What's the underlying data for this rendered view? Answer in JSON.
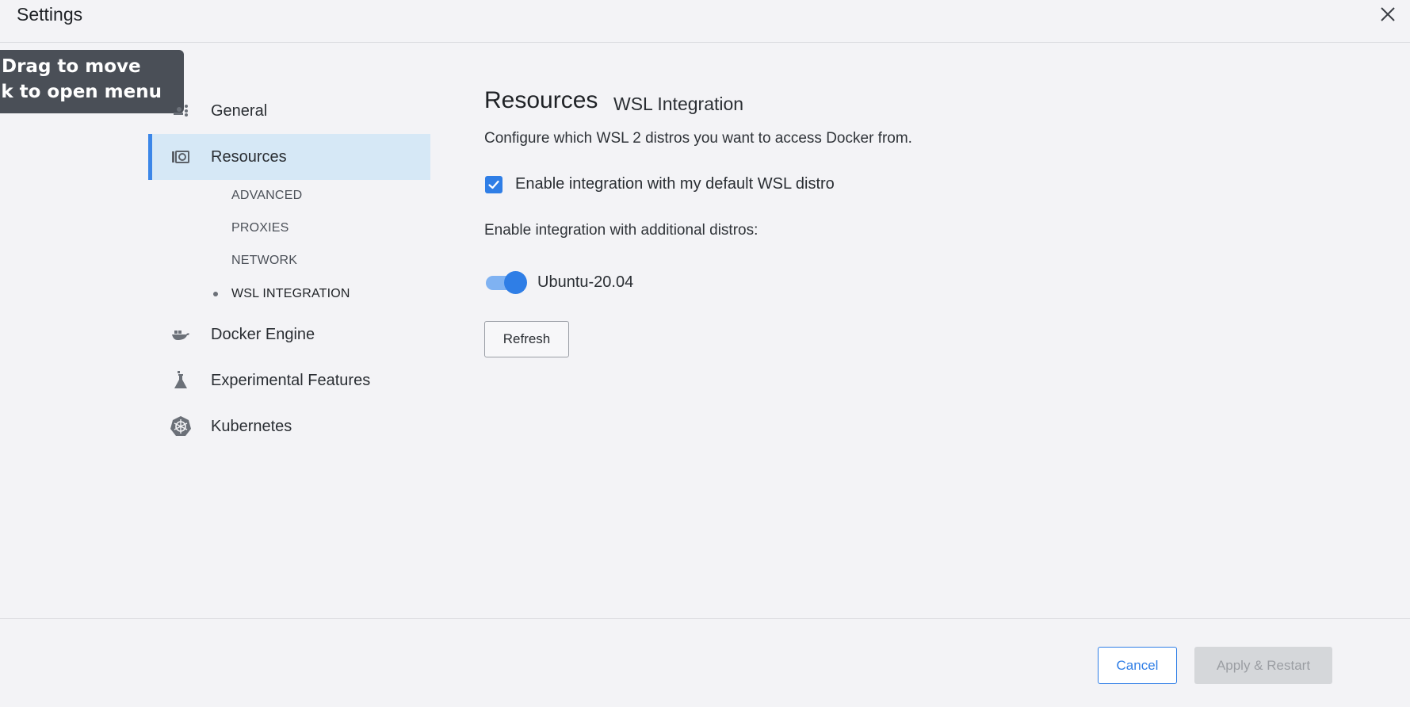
{
  "window": {
    "title": "Settings"
  },
  "tooltip": {
    "line1": "Drag to move",
    "line2": "ck to open menu"
  },
  "sidebar": {
    "items": [
      {
        "label": "General",
        "icon": "general-sliders-icon"
      },
      {
        "label": "Resources",
        "icon": "resources-icon",
        "active": true
      },
      {
        "label": "Docker Engine",
        "icon": "docker-whale-icon"
      },
      {
        "label": "Experimental Features",
        "icon": "flask-icon"
      },
      {
        "label": "Kubernetes",
        "icon": "kubernetes-helm-icon"
      }
    ],
    "sub_items": [
      {
        "label": "ADVANCED"
      },
      {
        "label": "PROXIES"
      },
      {
        "label": "NETWORK"
      },
      {
        "label": "WSL INTEGRATION",
        "current": true
      }
    ]
  },
  "main": {
    "title": "Resources",
    "subtitle": "WSL Integration",
    "description": "Configure which WSL 2 distros you want to access Docker from.",
    "default_distro_checkbox": {
      "label": "Enable integration with my default WSL distro",
      "checked": true
    },
    "additional_label": "Enable integration with additional distros:",
    "distros": [
      {
        "name": "Ubuntu-20.04",
        "enabled": true
      }
    ],
    "refresh_label": "Refresh"
  },
  "footer": {
    "cancel_label": "Cancel",
    "apply_label": "Apply & Restart"
  },
  "colors": {
    "accent": "#2f7ee6",
    "active_nav_bg": "#d6e8f6",
    "disabled_button_bg": "#d5d7da"
  }
}
